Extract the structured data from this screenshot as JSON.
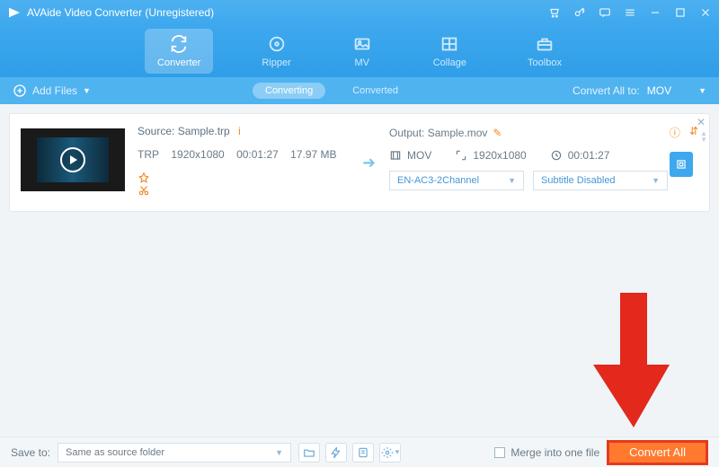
{
  "window": {
    "title": "AVAide Video Converter (Unregistered)"
  },
  "nav": {
    "converter": "Converter",
    "ripper": "Ripper",
    "mv": "MV",
    "collage": "Collage",
    "toolbox": "Toolbox"
  },
  "subbar": {
    "add_files": "Add Files",
    "converting": "Converting",
    "converted": "Converted",
    "convert_all_to": "Convert All to:",
    "format": "MOV"
  },
  "item": {
    "source_label": "Source:",
    "source_name": "Sample.trp",
    "src_format": "TRP",
    "src_res": "1920x1080",
    "src_dur": "00:01:27",
    "src_size": "17.97 MB",
    "output_label": "Output:",
    "output_name": "Sample.mov",
    "out_format": "MOV",
    "out_res": "1920x1080",
    "out_dur": "00:01:27",
    "audio_track": "EN-AC3-2Channel",
    "subtitle": "Subtitle Disabled"
  },
  "footer": {
    "save_to_label": "Save to:",
    "save_to_value": "Same as source folder",
    "merge_label": "Merge into one file",
    "convert_all": "Convert All"
  },
  "colors": {
    "accent": "#3ea8ee",
    "cta": "#ff7a2f",
    "cta_border": "#e53a1e"
  }
}
